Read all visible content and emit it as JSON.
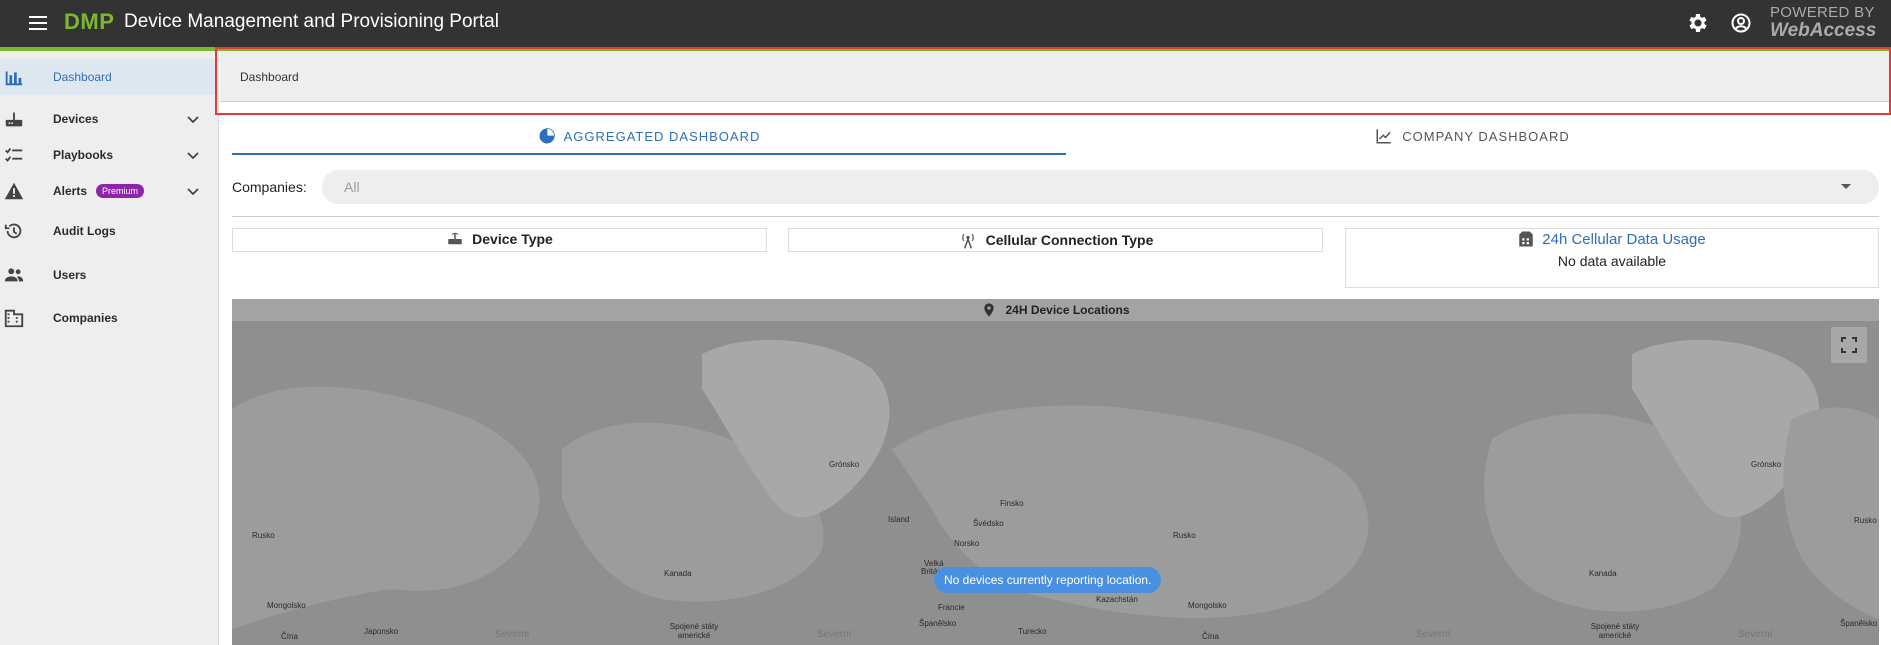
{
  "header": {
    "brand": "DMP",
    "title": "Device Management and Provisioning Portal",
    "powered_line1": "POWERED BY",
    "powered_line2": "WebAccess"
  },
  "sidebar": {
    "items": [
      {
        "label": "Dashboard",
        "icon": "bar-chart-icon"
      },
      {
        "label": "Devices",
        "icon": "router-icon"
      },
      {
        "label": "Playbooks",
        "icon": "checklist-icon"
      },
      {
        "label": "Alerts",
        "icon": "warning-icon",
        "badge": "Premium"
      },
      {
        "label": "Audit Logs",
        "icon": "history-icon"
      },
      {
        "label": "Users",
        "icon": "people-icon"
      },
      {
        "label": "Companies",
        "icon": "building-icon"
      }
    ]
  },
  "breadcrumb": {
    "current": "Dashboard"
  },
  "tabs": [
    {
      "label": "AGGREGATED DASHBOARD",
      "icon": "pie-chart-icon",
      "active": true
    },
    {
      "label": "COMPANY DASHBOARD",
      "icon": "line-chart-icon",
      "active": false
    }
  ],
  "filters": {
    "companies_label": "Companies:",
    "companies_value": "All"
  },
  "cards": {
    "device_type": {
      "title": "Device Type"
    },
    "cellular_connection": {
      "title": "Cellular Connection Type"
    },
    "data_usage": {
      "title": "24h Cellular Data Usage",
      "body": "No data available"
    }
  },
  "map": {
    "title": "24H Device Locations",
    "toast": "No devices currently reporting location.",
    "labels": {
      "gronsko_1": "Grónsko",
      "gronsko_2": "Grónsko",
      "rusko_1": "Rusko",
      "rusko_2": "Rusko",
      "rusko_3": "Rusko",
      "kanada_1": "Kanada",
      "kanada_2": "Kanada",
      "island": "Island",
      "finsko": "Finsko",
      "svedsko": "Švédsko",
      "norsko": "Norsko",
      "velka": "Velká",
      "britanie": "Británie",
      "francie": "Francie",
      "spanelsko_1": "Španělsko",
      "spanelsko_2": "Španělsko",
      "kazachstan": "Kazachstán",
      "mongolsko_1": "Mongolsko",
      "mongolsko_2": "Mongolsko",
      "cina_1": "Čína",
      "cina_2": "Čína",
      "japonsko": "Japonsko",
      "spojene_1": "Spojené státy americké",
      "spojene_2": "Spojené státy americké",
      "turecko": "Turecko",
      "severni_1": "Severní",
      "severni_2": "Severní",
      "severni_3": "Severní",
      "severni_4": "Severní"
    }
  },
  "colors": {
    "topbar": "#333333",
    "brand_green": "#7cb82f",
    "accent_blue": "#2d6fb8",
    "highlight_red": "#e53935",
    "premium_purple": "#8e24aa"
  }
}
